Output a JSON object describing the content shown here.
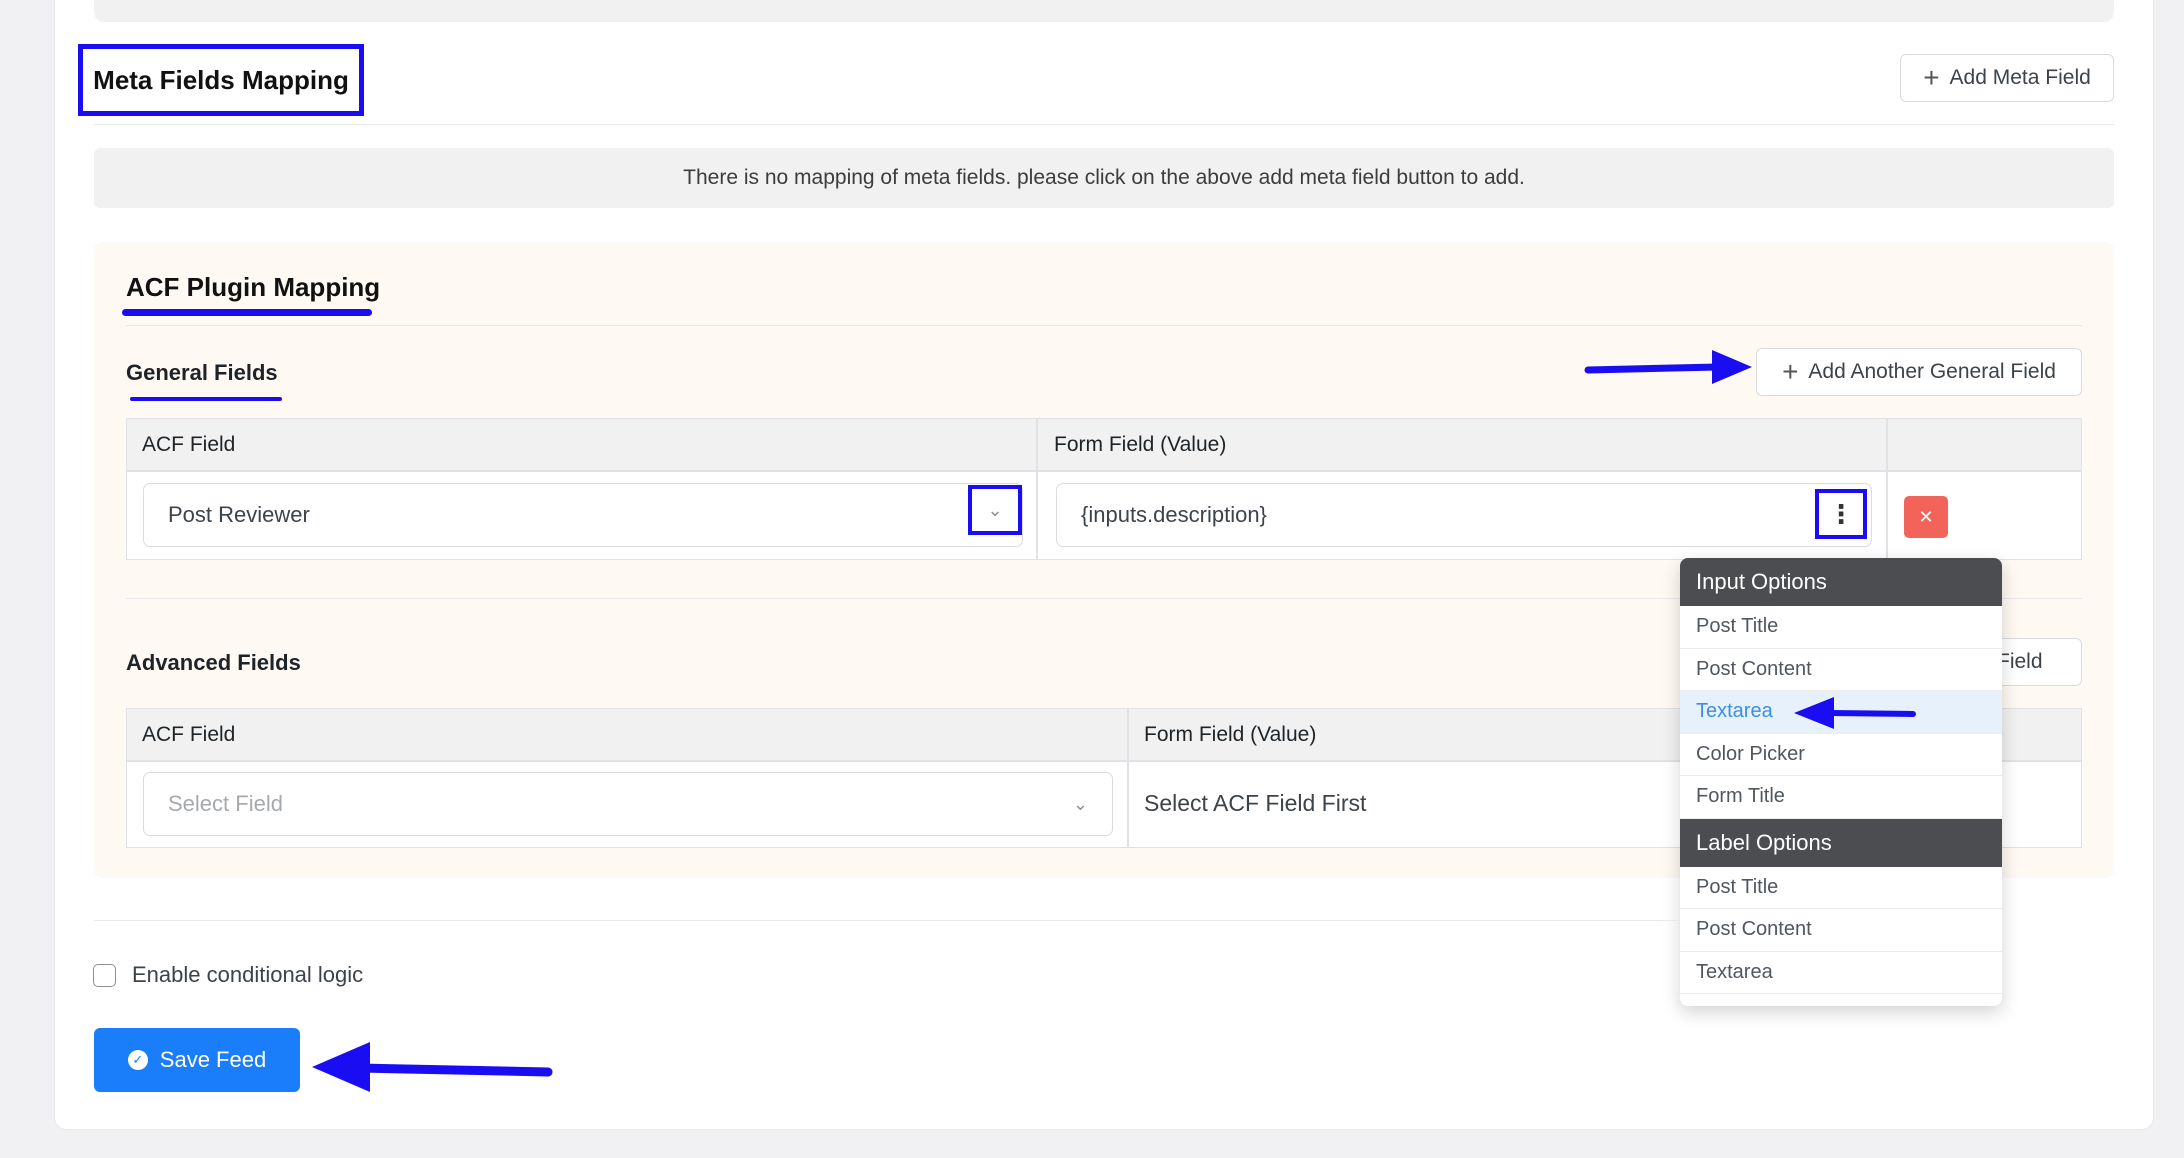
{
  "meta_fields": {
    "title": "Meta Fields Mapping",
    "add_button_label": "Add Meta Field",
    "notice": "There is no mapping of meta fields. please click on the above add meta field button to add."
  },
  "acf": {
    "title": "ACF Plugin Mapping",
    "general": {
      "title": "General Fields",
      "add_button_label": "Add Another General Field",
      "col_acf": "ACF Field",
      "col_form": "Form Field (Value)",
      "row": {
        "acf_value": "Post Reviewer",
        "form_value": "{inputs.description}"
      }
    },
    "advanced": {
      "title": "Advanced Fields",
      "add_button_partial": "d Field",
      "col_acf": "ACF Field",
      "col_form": "Form Field (Value)",
      "row": {
        "acf_placeholder": "Select Field",
        "form_text": "Select ACF Field First"
      }
    }
  },
  "dropdown": {
    "groups": [
      {
        "header": "Input Options",
        "items": [
          "Post Title",
          "Post Content",
          "Textarea",
          "Color Picker",
          "Form Title"
        ],
        "active_index": 2
      },
      {
        "header": "Label Options",
        "items": [
          "Post Title",
          "Post Content",
          "Textarea"
        ]
      }
    ]
  },
  "conditional": {
    "label": "Enable conditional logic",
    "checked": false
  },
  "save_button_label": "Save Feed",
  "colors": {
    "annotation": "#1a0df2",
    "primary": "#1a7efb",
    "danger": "#f2645a",
    "dropdown_header": "#4b4d50",
    "active_item": "#3a8ee6"
  },
  "icons": [
    "plus-icon",
    "chevron-down-icon",
    "more-vertical-icon",
    "close-icon",
    "check-circle-icon",
    "annotation-arrow"
  ]
}
